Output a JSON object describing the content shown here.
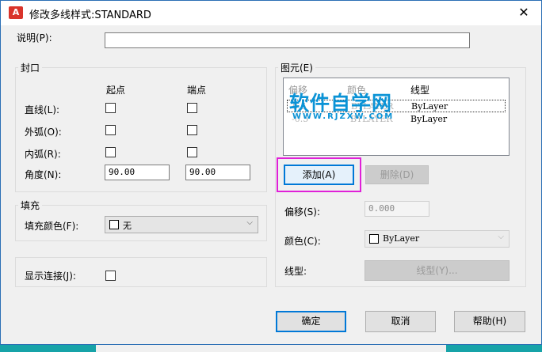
{
  "window": {
    "title": "修改多线样式:STANDARD",
    "app_icon_text": "A",
    "close_glyph": "✕"
  },
  "description": {
    "label": "说明(P):",
    "value": ""
  },
  "caps": {
    "title": "封口",
    "col_start": "起点",
    "col_end": "端点",
    "rows": [
      {
        "label": "直线(L):",
        "start_checked": false,
        "end_checked": false
      },
      {
        "label": "外弧(O):",
        "start_checked": false,
        "end_checked": false
      },
      {
        "label": "内弧(R):",
        "start_checked": false,
        "end_checked": false
      }
    ],
    "angle_label": "角度(N):",
    "angle_start": "90.00",
    "angle_end": "90.00"
  },
  "fill": {
    "title": "填充",
    "color_label": "填充颜色(F):",
    "color_value": "无"
  },
  "joints": {
    "label": "显示连接(J):",
    "checked": false
  },
  "elements": {
    "title": "图元(E)",
    "columns": [
      "偏移",
      "颜色",
      "线型"
    ],
    "rows": [
      {
        "offset": "0.5",
        "color": "BYLAYER",
        "linetype": "ByLayer"
      },
      {
        "offset": "-0.5",
        "color": "BYLAYER",
        "linetype": "ByLayer"
      }
    ],
    "add_label": "添加(A)",
    "delete_label": "删除(D)",
    "offset_label": "偏移(S):",
    "offset_value": "0.000",
    "color_label": "颜色(C):",
    "color_value": "ByLayer",
    "linetype_label": "线型:",
    "linetype_button": "线型(Y)..."
  },
  "watermark": {
    "main": "软件自学网",
    "sub": "WWW.RJZXW.COM"
  },
  "buttons": {
    "ok": "确定",
    "cancel": "取消",
    "help": "帮助(H)"
  },
  "colors": {
    "highlight": "#e020d8",
    "watermark": "#0b93d6",
    "backdrop": "#17a3a8",
    "focus": "#0078d7"
  }
}
